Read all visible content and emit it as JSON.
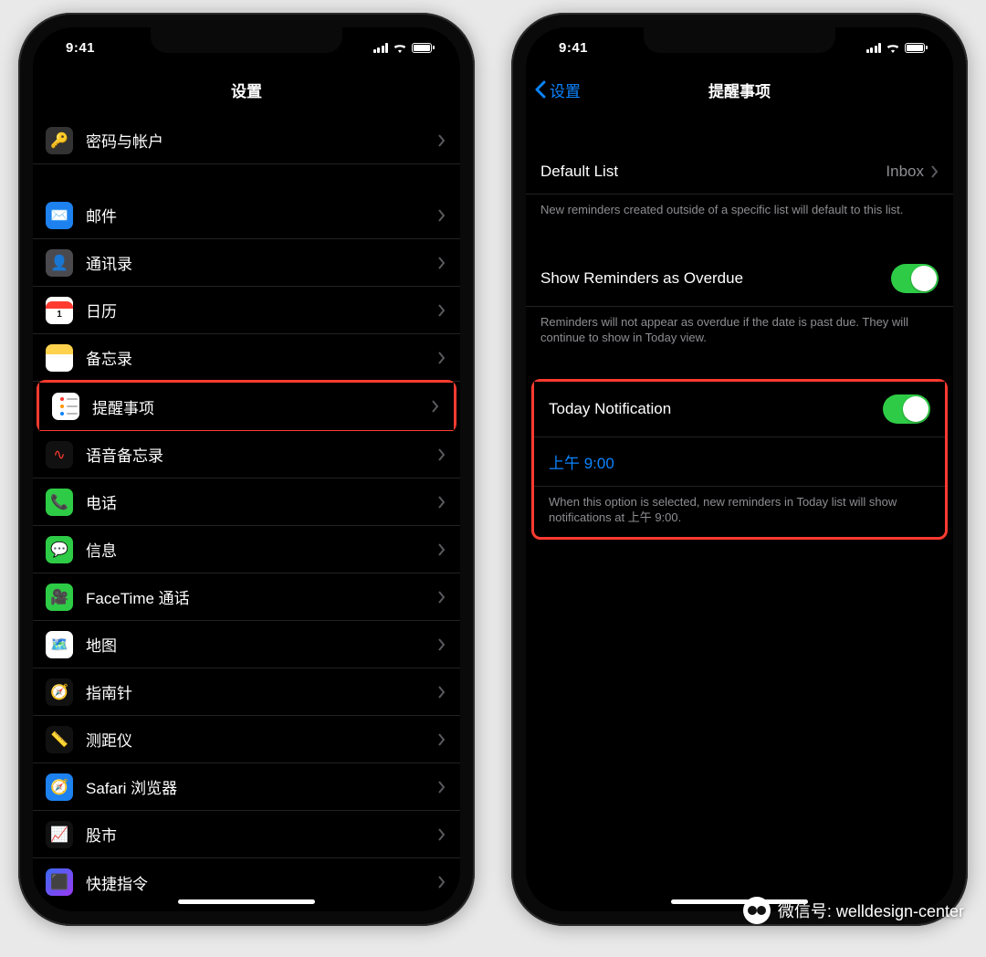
{
  "status": {
    "time": "9:41"
  },
  "left": {
    "title": "设置",
    "rows": [
      {
        "key": "passwords",
        "label": "密码与帐户"
      },
      {
        "key": "mail",
        "label": "邮件"
      },
      {
        "key": "contacts",
        "label": "通讯录"
      },
      {
        "key": "calendar",
        "label": "日历"
      },
      {
        "key": "notes",
        "label": "备忘录"
      },
      {
        "key": "reminders",
        "label": "提醒事项"
      },
      {
        "key": "voice",
        "label": "语音备忘录"
      },
      {
        "key": "phone",
        "label": "电话"
      },
      {
        "key": "messages",
        "label": "信息"
      },
      {
        "key": "facetime",
        "label": "FaceTime 通话"
      },
      {
        "key": "maps",
        "label": "地图"
      },
      {
        "key": "compass",
        "label": "指南针"
      },
      {
        "key": "measure",
        "label": "测距仪"
      },
      {
        "key": "safari",
        "label": "Safari 浏览器"
      },
      {
        "key": "stocks",
        "label": "股市"
      },
      {
        "key": "shortcuts",
        "label": "快捷指令"
      }
    ],
    "highlighted_row_key": "reminders"
  },
  "right": {
    "back_label": "设置",
    "title": "提醒事项",
    "default_list": {
      "title": "Default List",
      "value": "Inbox"
    },
    "default_list_footer": "New reminders created outside of a specific list will default to this list.",
    "overdue": {
      "title": "Show Reminders as Overdue",
      "on": true
    },
    "overdue_footer": "Reminders will not appear as overdue if the date is past due. They will continue to show in Today view.",
    "today": {
      "title": "Today Notification",
      "on": true,
      "time": "上午 9:00"
    },
    "today_footer": "When this option is selected, new reminders in Today list will show notifications at 上午 9:00."
  },
  "watermark": "微信号: welldesign-center",
  "colors": {
    "link": "#0b84ff",
    "toggle_on": "#2ecc46",
    "highlight": "#ff3b30"
  }
}
